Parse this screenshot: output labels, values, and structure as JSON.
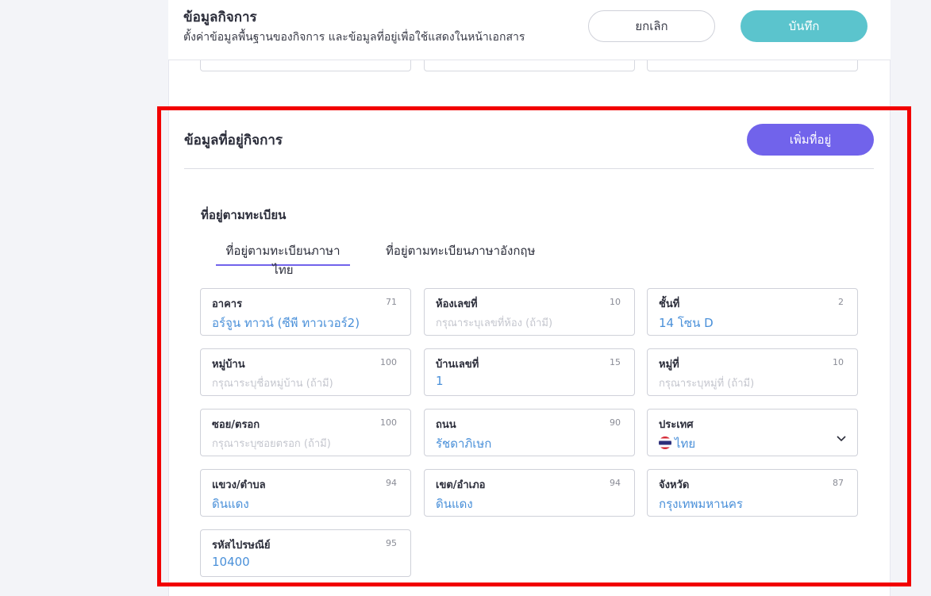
{
  "header": {
    "title": "ข้อมูลกิจการ",
    "subtitle": "ตั้งค่าข้อมูลพื้นฐานของกิจการ และข้อมูลที่อยู่เพื่อใช้แสดงในหน้าเอกสาร",
    "cancel_label": "ยกเลิก",
    "save_label": "บันทึก"
  },
  "section": {
    "title": "ข้อมูลที่อยู่กิจการ",
    "add_label": "เพิ่มที่อยู่",
    "subtitle": "ที่อยู่ตามทะเบียน",
    "tabs": [
      {
        "label": "ที่อยู่ตามทะเบียนภาษาไทย",
        "active": true
      },
      {
        "label": "ที่อยู่ตามทะเบียนภาษาอังกฤษ",
        "active": false
      }
    ]
  },
  "fields": {
    "building": {
      "label": "อาคาร",
      "max": "71",
      "value": "อร์จูน ทาวน์ (ซีพี ทาวเวอร์2)"
    },
    "room": {
      "label": "ห้องเลขที่",
      "max": "10",
      "placeholder": "กรุณาระบุเลขที่ห้อง (ถ้ามี)"
    },
    "floor": {
      "label": "ชั้นที่",
      "max": "2",
      "value": "14 โซน D"
    },
    "village": {
      "label": "หมู่บ้าน",
      "max": "100",
      "placeholder": "กรุณาระบุชื่อหมู่บ้าน (ถ้ามี)"
    },
    "house_no": {
      "label": "บ้านเลขที่",
      "max": "15",
      "value": "1"
    },
    "moo": {
      "label": "หมู่ที่",
      "max": "10",
      "placeholder": "กรุณาระบุหมู่ที่ (ถ้ามี)"
    },
    "soi": {
      "label": "ซอย/ตรอก",
      "max": "100",
      "placeholder": "กรุณาระบุซอยตรอก (ถ้ามี)"
    },
    "road": {
      "label": "ถนน",
      "max": "90",
      "value": "รัชดาภิเษก"
    },
    "country": {
      "label": "ประเทศ",
      "value": "ไทย",
      "flag_icon": "thailand-flag-icon"
    },
    "subdistrict": {
      "label": "แขวง/ตำบล",
      "max": "94",
      "value": "ดินแดง"
    },
    "district": {
      "label": "เขต/อำเภอ",
      "max": "94",
      "value": "ดินแดง"
    },
    "province": {
      "label": "จังหวัด",
      "max": "87",
      "value": "กรุงเทพมหานคร"
    },
    "postal": {
      "label": "รหัสไปรษณีย์",
      "max": "95",
      "value": "10400"
    }
  },
  "colors": {
    "accent_purple": "#7163eb",
    "save_teal": "#5bc4cd",
    "value_blue": "#4a90d9",
    "highlight_red": "#f20000"
  }
}
